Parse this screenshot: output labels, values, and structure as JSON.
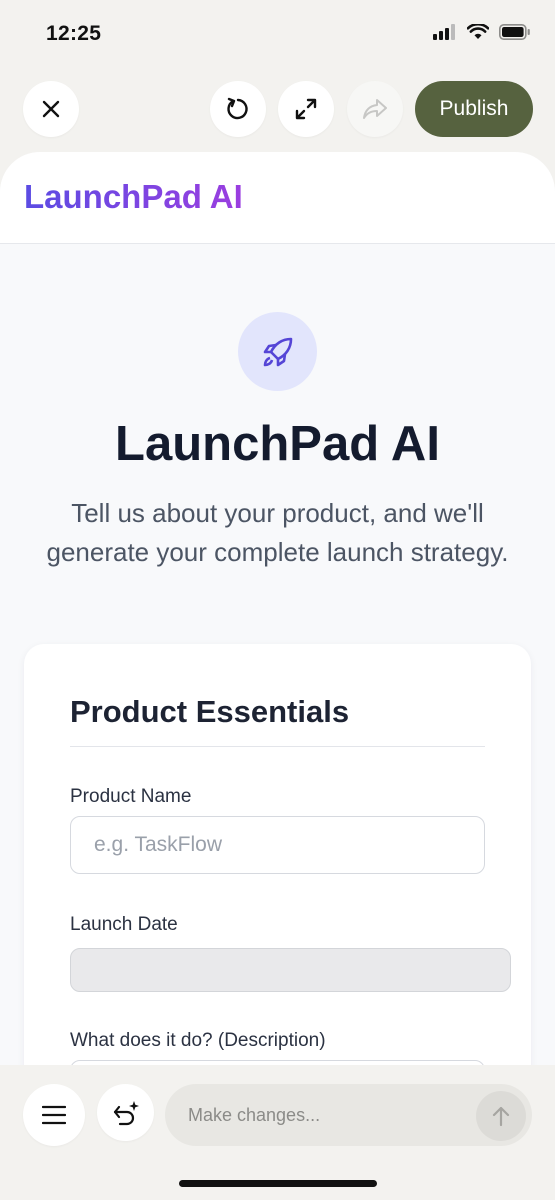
{
  "status_bar": {
    "time": "12:25"
  },
  "toolbar": {
    "close_icon": "close-icon",
    "refresh_icon": "refresh-icon",
    "expand_icon": "expand-icon",
    "share_icon": "share-icon",
    "publish_label": "Publish",
    "publish_color": "#56623f"
  },
  "app": {
    "brand": "LaunchPad AI",
    "brand_gradient": [
      "#5b4ce3",
      "#9b3ee0"
    ],
    "hero": {
      "icon": "rocket-icon",
      "title": "LaunchPad AI",
      "subtitle": "Tell us about your product, and we'll generate your complete launch strategy."
    },
    "form": {
      "section_title": "Product Essentials",
      "fields": [
        {
          "label": "Product Name",
          "placeholder": "e.g. TaskFlow",
          "value": ""
        },
        {
          "label": "Launch Date",
          "value": ""
        },
        {
          "label": "What does it do? (Description)",
          "value": ""
        }
      ]
    }
  },
  "bottom_bar": {
    "menu_icon": "menu-icon",
    "undo_icon": "undo-sparkle-icon",
    "prompt_placeholder": "Make changes...",
    "send_icon": "arrow-up-icon"
  }
}
